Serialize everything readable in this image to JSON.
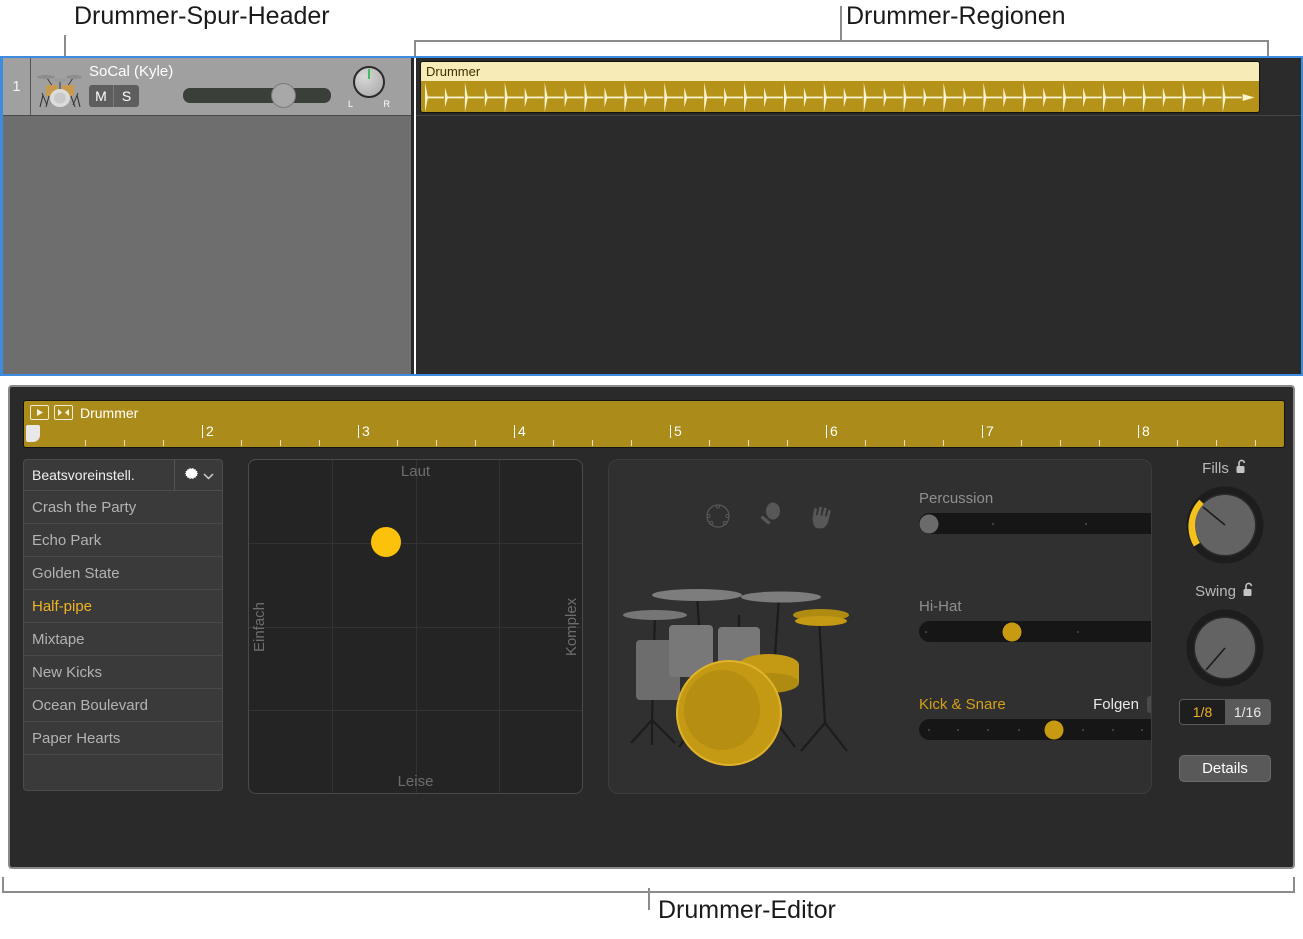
{
  "callouts": {
    "track_header": "Drummer-Spur-Header",
    "regions": "Drummer-Regionen",
    "editor": "Drummer-Editor"
  },
  "arrange": {
    "track": {
      "number": "1",
      "name": "SoCal (Kyle)",
      "mute_label": "M",
      "solo_label": "S",
      "pan_left_label": "L",
      "pan_right_label": "R",
      "icon": "drum-kit-icon"
    },
    "region": {
      "title": "Drummer"
    }
  },
  "editor": {
    "ruler": {
      "label": "Drummer",
      "play_icon": "play-icon",
      "cycle_icon": "region-bounds-icon",
      "bar_numbers": [
        "2",
        "3",
        "4",
        "5",
        "6",
        "7",
        "8"
      ]
    },
    "presets": {
      "header_label": "Beatsvoreinstell.",
      "gear_icon": "gear-icon",
      "chevron_icon": "chevron-down-icon",
      "items": [
        {
          "label": "Crash the Party",
          "selected": false
        },
        {
          "label": "Echo Park",
          "selected": false
        },
        {
          "label": "Golden State",
          "selected": false
        },
        {
          "label": "Half-pipe",
          "selected": true
        },
        {
          "label": "Mixtape",
          "selected": false
        },
        {
          "label": "New Kicks",
          "selected": false
        },
        {
          "label": "Ocean Boulevard",
          "selected": false
        },
        {
          "label": "Paper Hearts",
          "selected": false
        }
      ]
    },
    "xy_pad": {
      "top_label": "Laut",
      "bottom_label": "Leise",
      "left_label": "Einfach",
      "right_label": "Komplex",
      "puck_color": "#fcc10a"
    },
    "kit": {
      "percussion_icons": [
        "tambourine-icon",
        "shaker-icon",
        "hand-clap-icon"
      ],
      "sliders": [
        {
          "name": "Percussion",
          "active": false,
          "value_pct": 4,
          "thumb": "grey",
          "dots": [
            30,
            68,
            98
          ]
        },
        {
          "name": "Hi-Hat",
          "active": false,
          "value_pct": 38,
          "thumb": "gold",
          "dots": [
            3,
            65,
            97
          ]
        },
        {
          "name": "Kick & Snare",
          "active": true,
          "value_pct": 55,
          "thumb": "gold",
          "dots": [
            4,
            16,
            28,
            41,
            67,
            79,
            91,
            98
          ]
        }
      ],
      "follow": {
        "label": "Folgen",
        "checked": false
      }
    },
    "controls": {
      "fills": {
        "label": "Fills",
        "lock_icon": "unlocked-padlock-icon",
        "value_pct": 22
      },
      "swing": {
        "label": "Swing",
        "lock_icon": "unlocked-padlock-icon",
        "value_pct": 35
      },
      "swing_division": {
        "options": [
          "1/8",
          "1/16"
        ],
        "selected": "1/8"
      },
      "details_label": "Details"
    }
  },
  "colors": {
    "accent_gold": "#f0b323",
    "region_gold": "#b59318",
    "region_header": "#f7ebb8",
    "selection_blue": "#3c8ce0",
    "editor_bg": "#2a2a2a"
  }
}
